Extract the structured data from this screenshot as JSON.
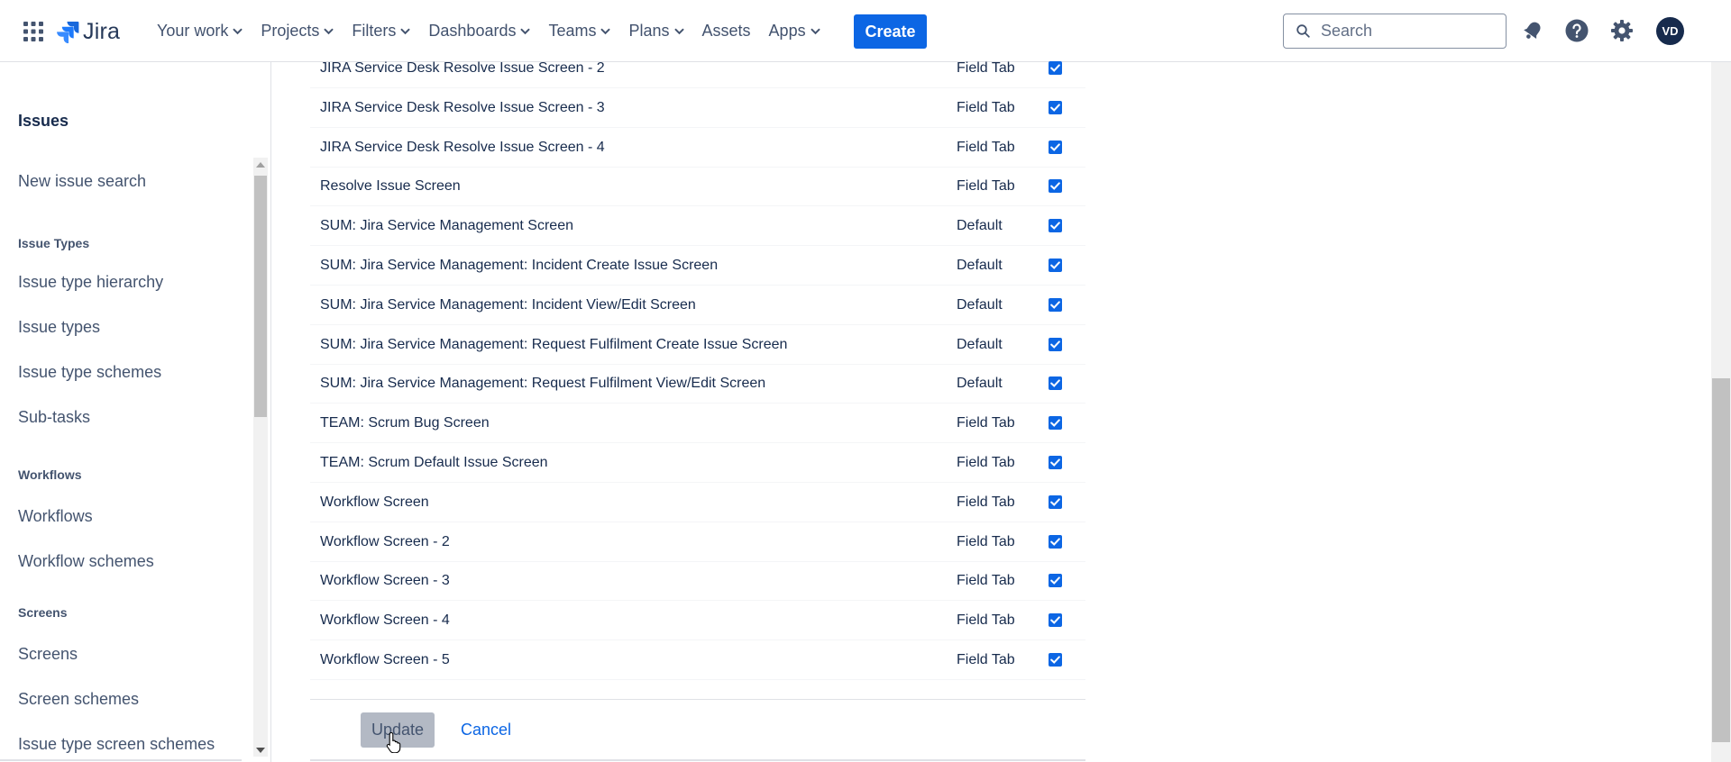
{
  "nav": {
    "logo_text": "Jira",
    "items": [
      {
        "label": "Your work",
        "has_chevron": true
      },
      {
        "label": "Projects",
        "has_chevron": true
      },
      {
        "label": "Filters",
        "has_chevron": true
      },
      {
        "label": "Dashboards",
        "has_chevron": true
      },
      {
        "label": "Teams",
        "has_chevron": true
      },
      {
        "label": "Plans",
        "has_chevron": true
      },
      {
        "label": "Assets",
        "has_chevron": false
      },
      {
        "label": "Apps",
        "has_chevron": true
      }
    ],
    "create_label": "Create",
    "search_placeholder": "Search",
    "avatar_initials": "VD"
  },
  "sidebar": {
    "heading": "Issues",
    "items": [
      {
        "type": "link",
        "label": "New issue search"
      },
      {
        "type": "section",
        "label": "Issue Types"
      },
      {
        "type": "link",
        "label": "Issue type hierarchy"
      },
      {
        "type": "link",
        "label": "Issue types"
      },
      {
        "type": "link",
        "label": "Issue type schemes"
      },
      {
        "type": "link",
        "label": "Sub-tasks"
      },
      {
        "type": "section",
        "label": "Workflows"
      },
      {
        "type": "link",
        "label": "Workflows"
      },
      {
        "type": "link",
        "label": "Workflow schemes"
      },
      {
        "type": "section",
        "label": "Screens"
      },
      {
        "type": "link",
        "label": "Screens"
      },
      {
        "type": "link",
        "label": "Screen schemes"
      },
      {
        "type": "link",
        "label": "Issue type screen schemes"
      }
    ]
  },
  "screens": [
    {
      "name": "JIRA Service Desk Resolve Issue Screen - 2",
      "tab": "Field Tab",
      "checked": true
    },
    {
      "name": "JIRA Service Desk Resolve Issue Screen - 3",
      "tab": "Field Tab",
      "checked": true
    },
    {
      "name": "JIRA Service Desk Resolve Issue Screen - 4",
      "tab": "Field Tab",
      "checked": true
    },
    {
      "name": "Resolve Issue Screen",
      "tab": "Field Tab",
      "checked": true
    },
    {
      "name": "SUM: Jira Service Management Screen",
      "tab": "Default",
      "checked": true
    },
    {
      "name": "SUM: Jira Service Management: Incident Create Issue Screen",
      "tab": "Default",
      "checked": true
    },
    {
      "name": "SUM: Jira Service Management: Incident View/Edit Screen",
      "tab": "Default",
      "checked": true
    },
    {
      "name": "SUM: Jira Service Management: Request Fulfilment Create Issue Screen",
      "tab": "Default",
      "checked": true
    },
    {
      "name": "SUM: Jira Service Management: Request Fulfilment View/Edit Screen",
      "tab": "Default",
      "checked": true
    },
    {
      "name": "TEAM: Scrum Bug Screen",
      "tab": "Field Tab",
      "checked": true
    },
    {
      "name": "TEAM: Scrum Default Issue Screen",
      "tab": "Field Tab",
      "checked": true
    },
    {
      "name": "Workflow Screen",
      "tab": "Field Tab",
      "checked": true
    },
    {
      "name": "Workflow Screen - 2",
      "tab": "Field Tab",
      "checked": true
    },
    {
      "name": "Workflow Screen - 3",
      "tab": "Field Tab",
      "checked": true
    },
    {
      "name": "Workflow Screen - 4",
      "tab": "Field Tab",
      "checked": true
    },
    {
      "name": "Workflow Screen - 5",
      "tab": "Field Tab",
      "checked": true
    }
  ],
  "actions": {
    "update_label": "Update",
    "cancel_label": "Cancel"
  },
  "colors": {
    "brand_blue": "#0c66e4",
    "text": "#172b4d",
    "subtle_text": "#44546f",
    "disabled_button": "#b3b9c4"
  }
}
